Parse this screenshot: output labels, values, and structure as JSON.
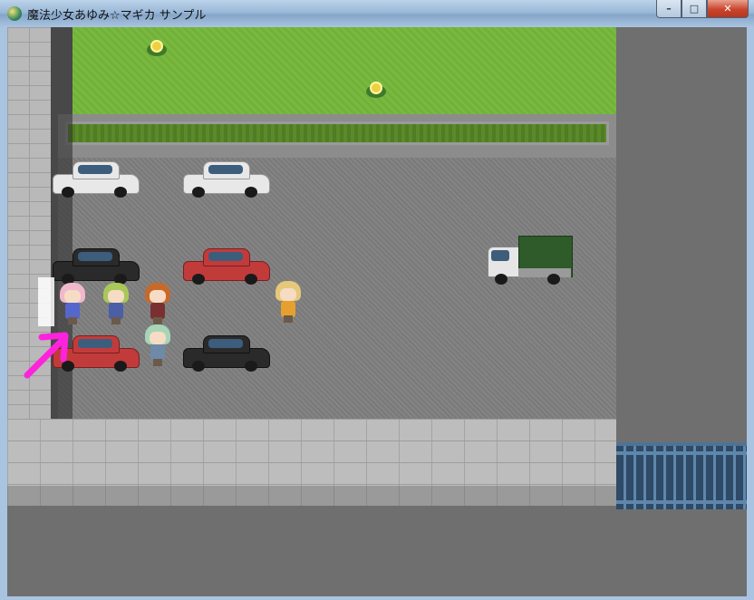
{
  "window": {
    "title": "魔法少女あゆみ☆マギカ サンプル",
    "controls": {
      "minimize": "–",
      "maximize": "□",
      "close": "✕"
    }
  },
  "scene": {
    "type": "rpg-map",
    "location": "parking-lot",
    "cars": [
      {
        "color": "white"
      },
      {
        "color": "white"
      },
      {
        "color": "black"
      },
      {
        "color": "red"
      },
      {
        "color": "red"
      },
      {
        "color": "black"
      }
    ],
    "truck": {
      "color": "green-bed"
    },
    "characters": [
      {
        "hair": "pink"
      },
      {
        "hair": "green"
      },
      {
        "hair": "orange"
      },
      {
        "hair": "mint"
      },
      {
        "hair": "blonde"
      }
    ],
    "marker": {
      "color": "#ff22dd",
      "icon": "arrow-up-right-icon"
    }
  },
  "colors": {
    "grass": "#79b93f",
    "asphalt": "#848484",
    "fence": "#2e4a66"
  }
}
